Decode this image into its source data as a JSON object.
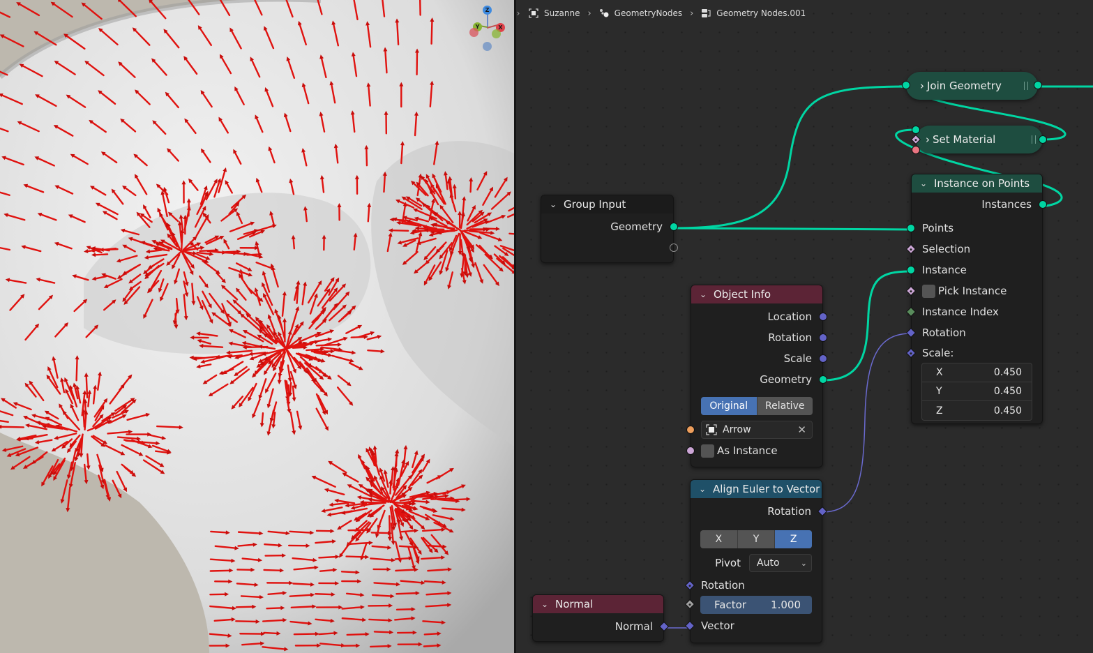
{
  "viewport": {
    "label": "3D Viewport",
    "gizmo": {
      "z": "Z",
      "y": "Y",
      "x": "X"
    },
    "colors": {
      "background": "#bdb8ae",
      "mesh": "#e6e6e6",
      "arrows": "#e0120f"
    }
  },
  "breadcrumb": {
    "items": [
      {
        "icon": "object-icon",
        "label": "Suzanne"
      },
      {
        "icon": "geometry-nodes-modifier-icon",
        "label": "GeometryNodes"
      },
      {
        "icon": "node-tree-icon",
        "label": "Geometry Nodes.001"
      }
    ]
  },
  "nodes": {
    "join_geometry": {
      "title": "Join Geometry"
    },
    "set_material": {
      "title": "Set Material"
    },
    "instance_on_points": {
      "title": "Instance on Points",
      "outputs": [
        "Instances"
      ],
      "inputs": [
        "Points",
        "Selection",
        "Instance",
        "Pick Instance",
        "Instance Index",
        "Rotation",
        "Scale:"
      ],
      "scale": {
        "x_label": "X",
        "x": "0.450",
        "y_label": "Y",
        "y": "0.450",
        "z_label": "Z",
        "z": "0.450"
      }
    },
    "group_input": {
      "title": "Group Input",
      "outputs": [
        "Geometry"
      ]
    },
    "object_info": {
      "title": "Object Info",
      "outputs": [
        "Location",
        "Rotation",
        "Scale",
        "Geometry"
      ],
      "transform_space": {
        "options": [
          "Original",
          "Relative"
        ],
        "selected": "Original"
      },
      "object": "Arrow",
      "as_instance_label": "As Instance"
    },
    "align_euler": {
      "title": "Align Euler to Vector",
      "outputs": [
        "Rotation"
      ],
      "axis": {
        "options": [
          "X",
          "Y",
          "Z"
        ],
        "selected": "Z"
      },
      "pivot_label": "Pivot",
      "pivot_value": "Auto",
      "inputs": [
        "Rotation",
        "Vector"
      ],
      "factor_label": "Factor",
      "factor_value": "1.000"
    },
    "normal": {
      "title": "Normal",
      "outputs": [
        "Normal"
      ]
    }
  },
  "colors": {
    "geometry_socket": "#00d6a3",
    "vector_socket": "#6363c7",
    "boolean_socket": "#cca6d6",
    "integer_socket": "#598c5c",
    "object_socket": "#ed9e5c",
    "material_socket": "#eb7582",
    "geometry_header": "#1e4d40",
    "input_header": "#5c2436",
    "vector_header": "#1f5068",
    "selected_button": "#4772b3"
  }
}
